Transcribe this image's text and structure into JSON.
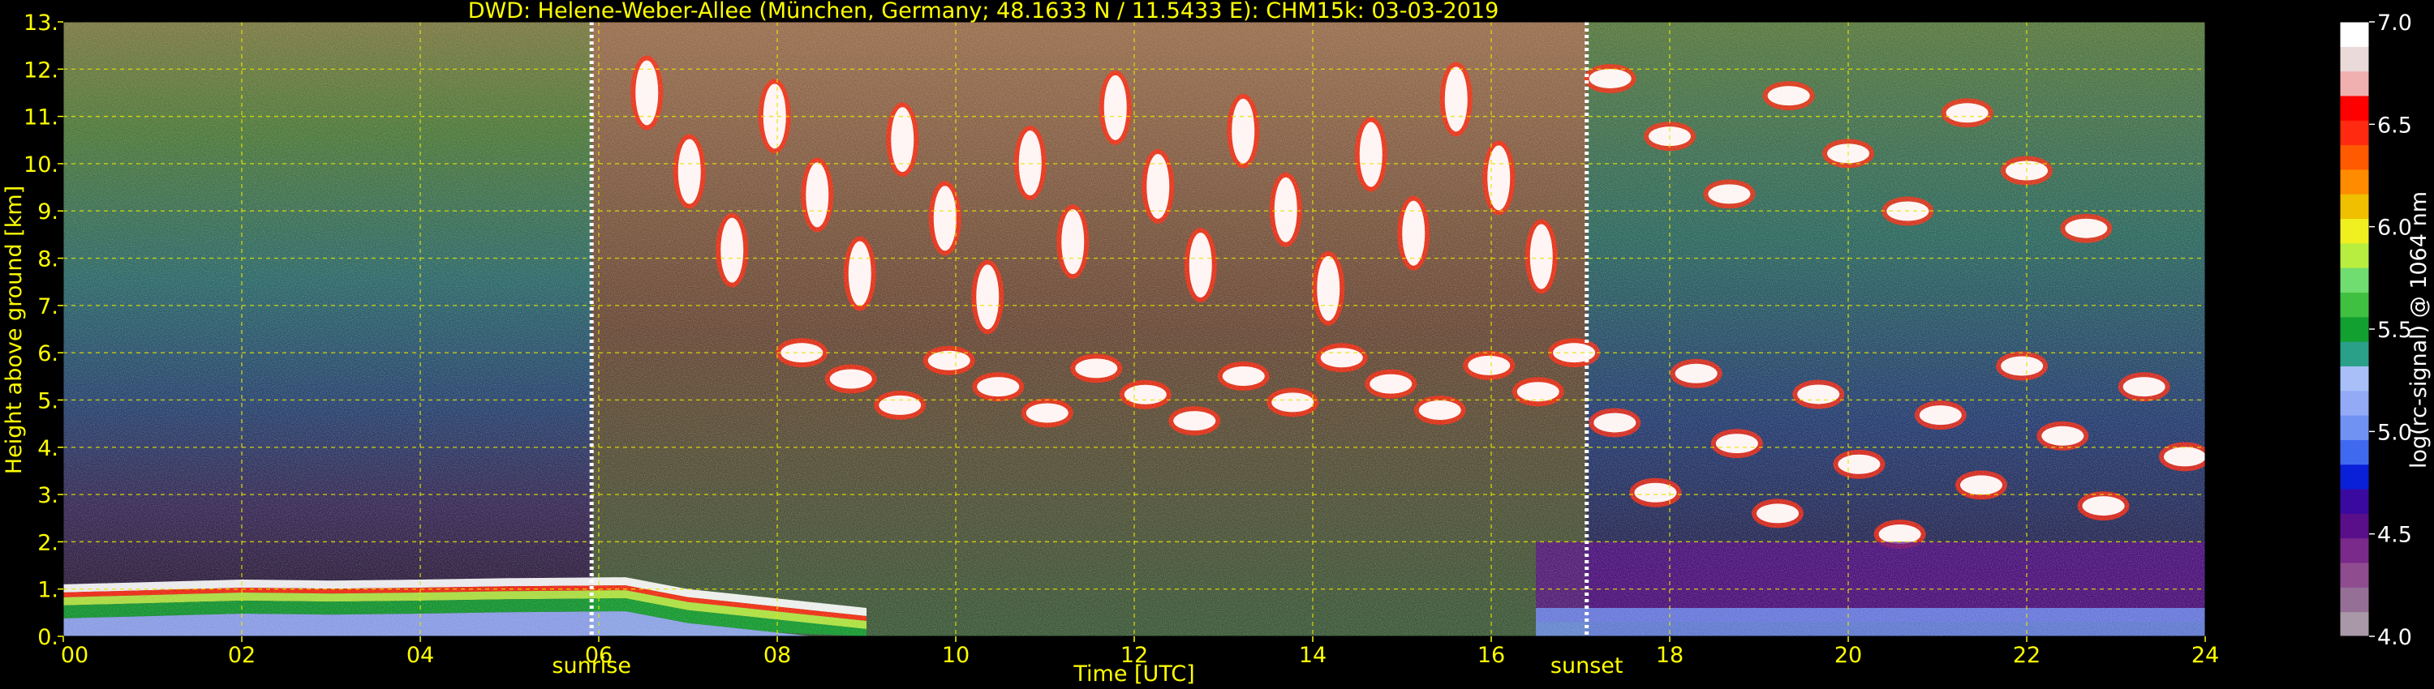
{
  "chart_data": {
    "type": "heatmap",
    "title": "DWD: Helene-Weber-Allee (München, Germany; 48.1633 N / 11.5433 E):    CHM15k: 03-03-2019",
    "xlabel": "Time [UTC]",
    "ylabel": "Height above ground [km]",
    "xlim": [
      0,
      24
    ],
    "ylim": [
      0,
      13
    ],
    "x_ticks": [
      0,
      2,
      4,
      6,
      8,
      10,
      12,
      14,
      16,
      18,
      20,
      22,
      24
    ],
    "x_tick_labels": [
      "00",
      "02",
      "04",
      "06",
      "08",
      "10",
      "12",
      "14",
      "16",
      "18",
      "20",
      "22",
      "24"
    ],
    "y_ticks": [
      0,
      1,
      2,
      3,
      4,
      5,
      6,
      7,
      8,
      9,
      10,
      11,
      12,
      13
    ],
    "y_tick_labels": [
      "0.",
      "1.",
      "2.",
      "3.",
      "4.",
      "5.",
      "6.",
      "7.",
      "8.",
      "9.",
      "10.",
      "11.",
      "12.",
      "13."
    ],
    "grid": true,
    "markers": [
      {
        "label": "sunrise",
        "x": 5.92
      },
      {
        "label": "sunset",
        "x": 17.07
      }
    ],
    "colorbar": {
      "label": "log(rc-signal) @ 1064 nm",
      "range": [
        4.0,
        7.0
      ],
      "tick_values": [
        4.0,
        4.5,
        5.0,
        5.5,
        6.0,
        6.5,
        7.0
      ],
      "tick_labels": [
        "4.0",
        "4.5",
        "5.0",
        "5.5",
        "6.0",
        "6.5",
        "7.0"
      ],
      "colors": [
        "#a898a8",
        "#966f96",
        "#8f4c8f",
        "#7a2a8a",
        "#5a0f8a",
        "#3a0aa0",
        "#0a1fd8",
        "#3f6af0",
        "#6f92f3",
        "#93aaf6",
        "#a8c0f7",
        "#2aa088",
        "#12a030",
        "#40c040",
        "#70dd70",
        "#b8ee40",
        "#f0f020",
        "#f0c000",
        "#ff8c00",
        "#ff5a00",
        "#ff2a10",
        "#ff0000",
        "#f0b0b0",
        "#eadada",
        "#ffffff"
      ]
    },
    "features": [
      {
        "kind": "boundary-layer-top",
        "x": [
          0,
          1,
          2,
          3,
          4,
          5,
          6.3,
          7,
          8,
          9
        ],
        "y": [
          1.1,
          1.15,
          1.2,
          1.18,
          1.2,
          1.23,
          1.25,
          1.0,
          0.8,
          0.6
        ]
      },
      {
        "kind": "cirrus-cloud",
        "x": [
          6.3,
          16.8
        ],
        "y": [
          7.0,
          11.5
        ]
      },
      {
        "kind": "mid-level-cloud",
        "x": [
          8.0,
          16.8
        ],
        "y": [
          4.5,
          6.0
        ]
      },
      {
        "kind": "cloud-layer",
        "x": [
          16.7,
          24.0
        ],
        "y": [
          2.0,
          6.0
        ]
      },
      {
        "kind": "high-cloud",
        "x": [
          17.0,
          23.0
        ],
        "y": [
          8.5,
          11.8
        ]
      },
      {
        "kind": "residual-layer",
        "x": [
          16.5,
          24.0
        ],
        "y": [
          0.3,
          2.0
        ]
      }
    ]
  }
}
